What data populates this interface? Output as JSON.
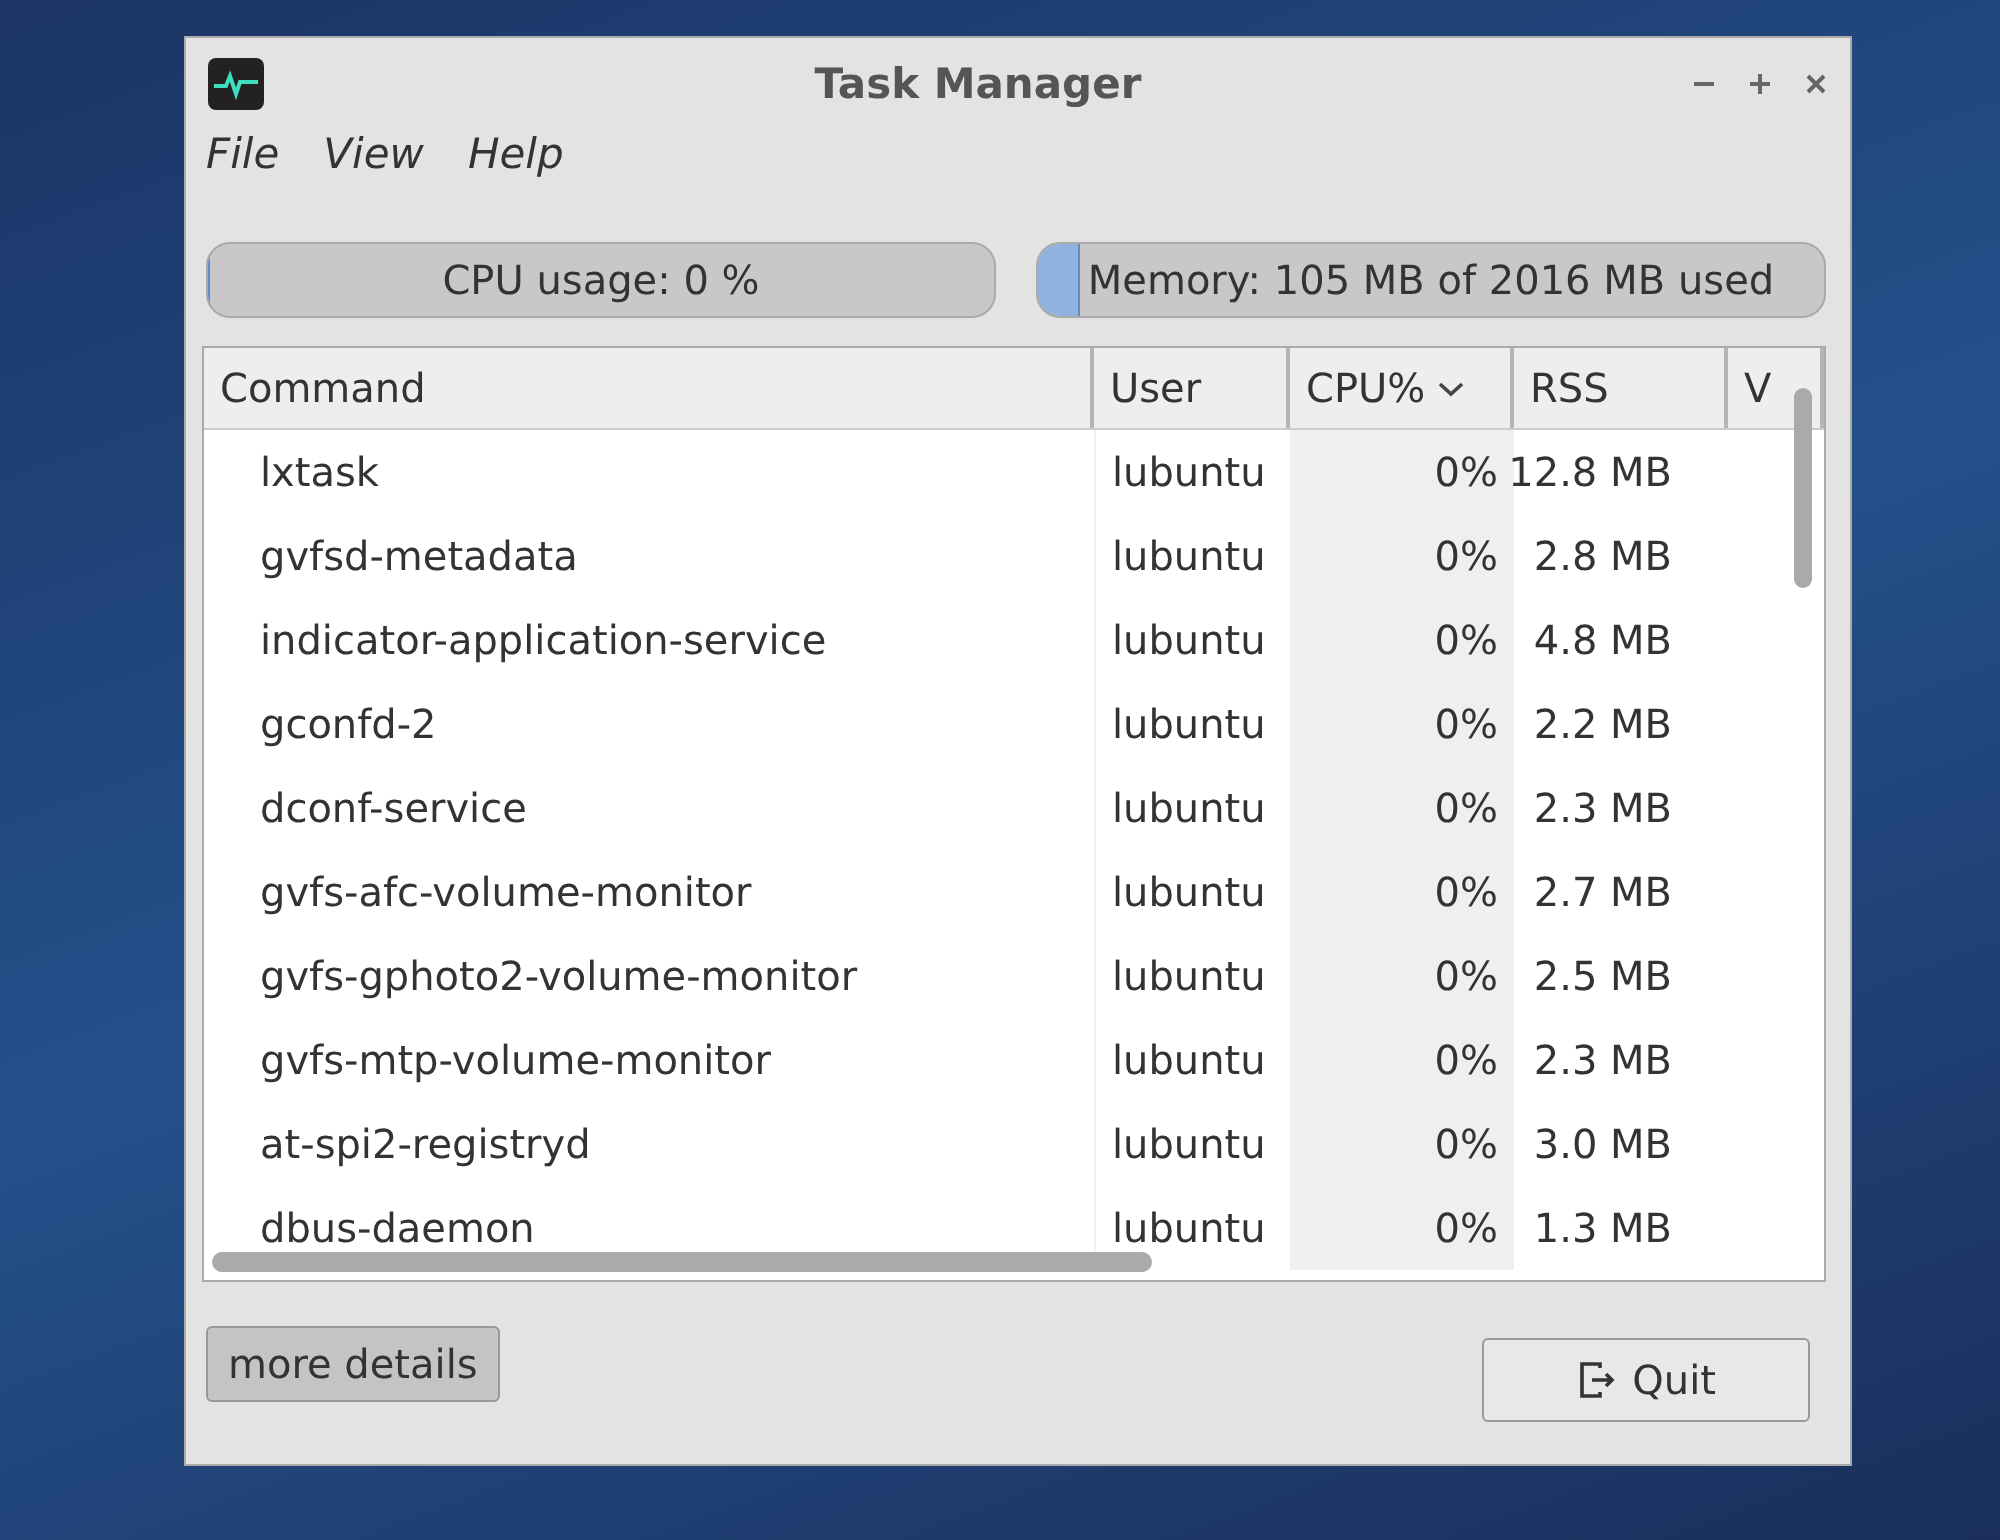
{
  "window": {
    "title": "Task Manager"
  },
  "menu": [
    "File",
    "View",
    "Help"
  ],
  "meters": [
    {
      "label": "CPU usage: 0 %",
      "level": 0
    },
    {
      "label": "Memory: 105 MB of 2016 MB used",
      "level": 0.05
    }
  ],
  "table": {
    "columns": [
      {
        "label": "Command",
        "sorted": false
      },
      {
        "label": "User",
        "sorted": false
      },
      {
        "label": "CPU%",
        "sorted": true
      },
      {
        "label": "RSS",
        "sorted": false
      },
      {
        "label": "V",
        "sorted": false
      }
    ],
    "rows": [
      [
        "lxtask",
        "lubuntu",
        "0%",
        "12.8 MB"
      ],
      [
        "gvfsd-metadata",
        "lubuntu",
        "0%",
        "2.8 MB"
      ],
      [
        "indicator-application-service",
        "lubuntu",
        "0%",
        "4.8 MB"
      ],
      [
        "gconfd-2",
        "lubuntu",
        "0%",
        "2.2 MB"
      ],
      [
        "dconf-service",
        "lubuntu",
        "0%",
        "2.3 MB"
      ],
      [
        "gvfs-afc-volume-monitor",
        "lubuntu",
        "0%",
        "2.7 MB"
      ],
      [
        "gvfs-gphoto2-volume-monitor",
        "lubuntu",
        "0%",
        "2.5 MB"
      ],
      [
        "gvfs-mtp-volume-monitor",
        "lubuntu",
        "0%",
        "2.3 MB"
      ],
      [
        "at-spi2-registryd",
        "lubuntu",
        "0%",
        "3.0 MB"
      ],
      [
        "dbus-daemon",
        "lubuntu",
        "0%",
        "1.3 MB"
      ]
    ]
  },
  "buttons": {
    "details": "more details",
    "quit": "Quit"
  }
}
